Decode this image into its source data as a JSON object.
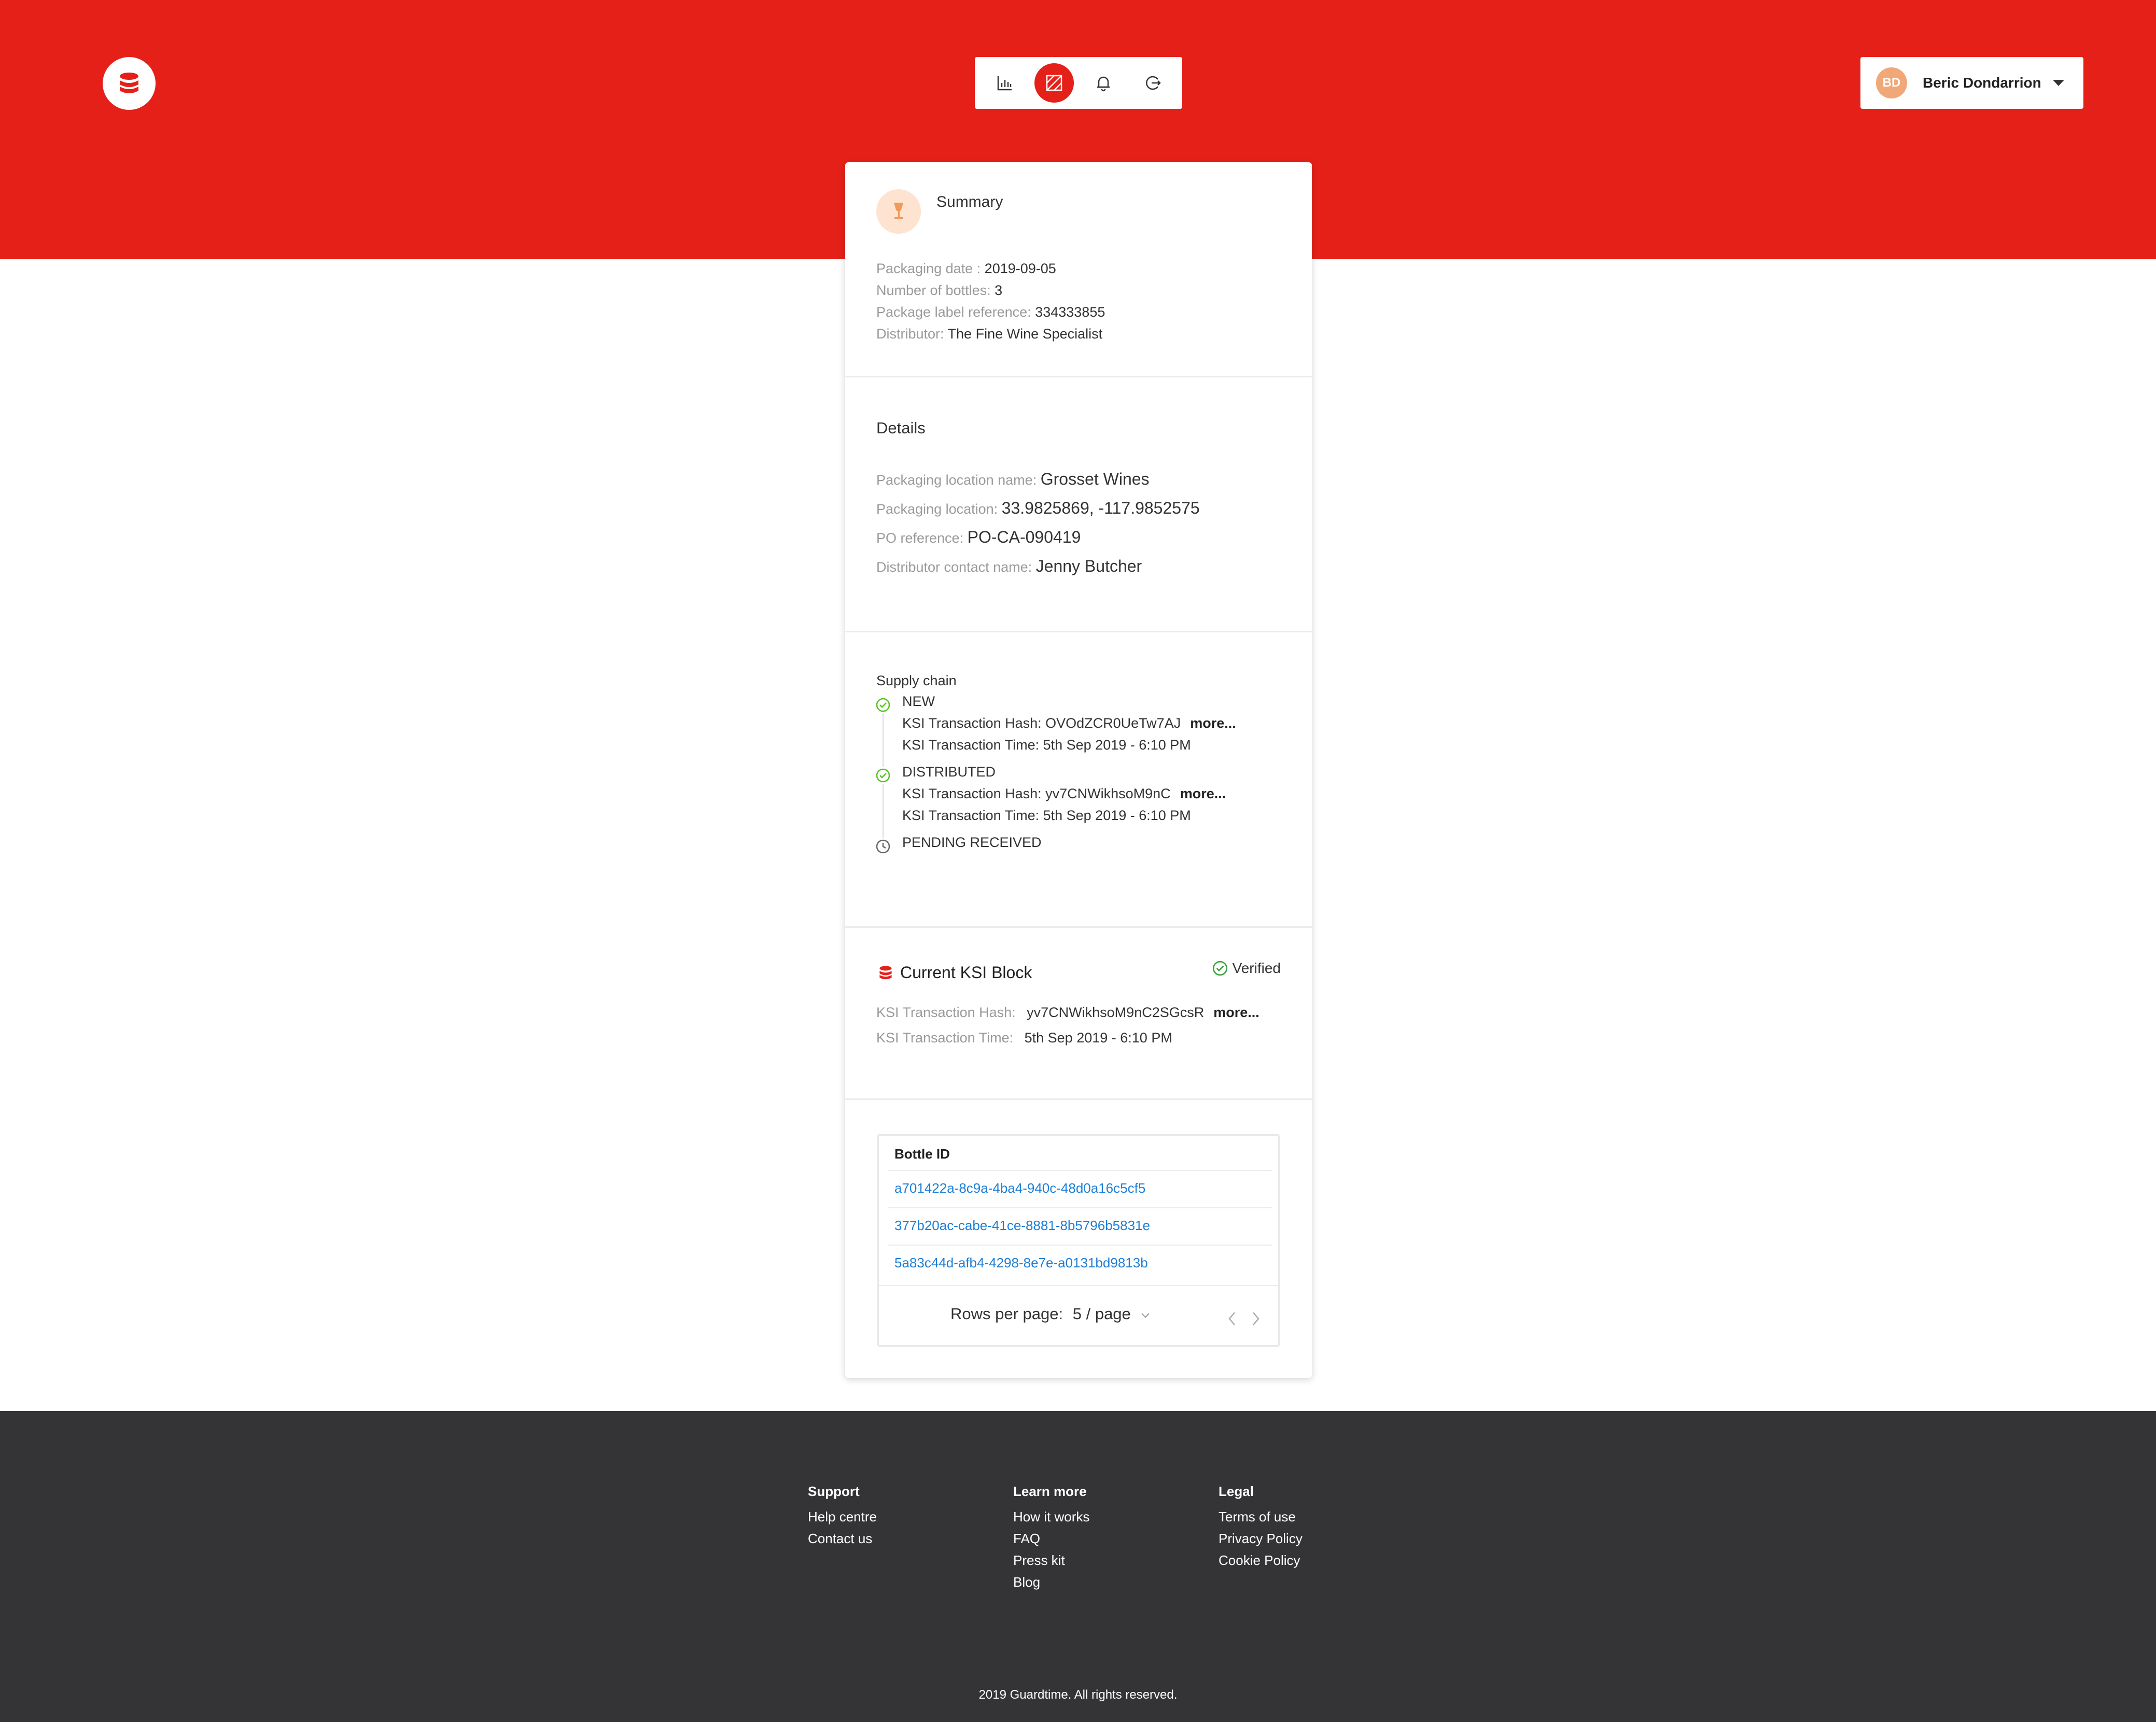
{
  "header": {
    "nav": [
      {
        "name": "analytics-icon"
      },
      {
        "name": "package-icon",
        "active": true
      },
      {
        "name": "notification-icon"
      },
      {
        "name": "logout-icon"
      }
    ],
    "user": {
      "initials": "BD",
      "name": "Beric Dondarrion"
    },
    "colors": {
      "brand": "#e52019",
      "avatar": "#f0a878"
    }
  },
  "summary": {
    "title": "Summary",
    "packaging_date_label": "Packaging date :",
    "packaging_date": "2019-09-05",
    "bottles_label": "Number of bottles:",
    "bottles": "3",
    "label_ref_label": "Package label reference:",
    "label_ref": "334333855",
    "distributor_label": "Distributor:",
    "distributor": "The Fine Wine Specialist"
  },
  "details": {
    "title": "Details",
    "location_name_label": "Packaging location name:",
    "location_name": "Grosset Wines",
    "location_label": "Packaging location:",
    "location": "33.9825869, -117.9852575",
    "po_label": "PO reference:",
    "po": "PO-CA-090419",
    "contact_label": "Distributor contact name:",
    "contact": "Jenny Butcher"
  },
  "supply_chain": {
    "title": "Supply chain",
    "steps": [
      {
        "status": "NEW",
        "hash_line": "KSI Transaction Hash: OVOdZCR0UeTw7AJ",
        "more": "more...",
        "time_line": "KSI Transaction Time: 5th Sep 2019 - 6:10 PM"
      },
      {
        "status": "DISTRIBUTED",
        "hash_line": "KSI Transaction Hash: yv7CNWikhsoM9nC",
        "more": "more...",
        "time_line": "KSI Transaction Time: 5th Sep 2019 - 6:10 PM"
      },
      {
        "status": "PENDING RECEIVED"
      }
    ]
  },
  "ksi_block": {
    "title": "Current KSI Block",
    "verified": "Verified",
    "hash_label": "KSI Transaction Hash:",
    "hash": "yv7CNWikhsoM9nC2SGcsR",
    "more": "more...",
    "time_label": "KSI Transaction Time:",
    "time": "5th Sep 2019 - 6:10 PM"
  },
  "bottles_table": {
    "header": "Bottle ID",
    "rows": [
      "a701422a-8c9a-4ba4-940c-48d0a16c5cf5",
      "377b20ac-cabe-41ce-8881-8b5796b5831e",
      "5a83c44d-afb4-4298-8e7e-a0131bd9813b"
    ],
    "rows_per_page_label": "Rows per page:",
    "page_size": "5 / page"
  },
  "footer": {
    "columns": [
      {
        "title": "Support",
        "links": [
          "Help centre",
          "Contact us"
        ]
      },
      {
        "title": "Learn more",
        "links": [
          "How it works",
          "FAQ",
          "Press kit",
          "Blog"
        ]
      },
      {
        "title": "Legal",
        "links": [
          "Terms of use",
          "Privacy Policy",
          "Cookie Policy"
        ]
      }
    ],
    "copyright": "2019 Guardtime. All rights reserved."
  }
}
